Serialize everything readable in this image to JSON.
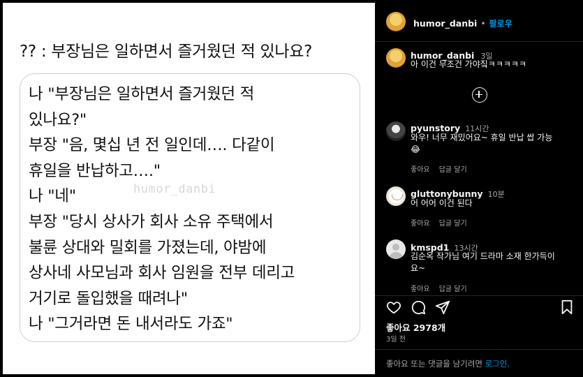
{
  "post_image": {
    "question": "?? : 부장님은 일하면서 즐거웠던 적 있나요?",
    "lines": [
      "나 \"부장님은 일하면서 즐거웠던 적",
      "있나요?\"",
      "부장 \"음, 몇십 년 전 일인데…. 다같이",
      "휴일을 반납하고….\"",
      "나 \"네\"",
      "부장 \"당시 상사가 회사 소유 주택에서",
      "불륜 상대와 밀회를 가졌는데, 야밤에",
      "상사네 사모님과 회사 임원을 전부 데리고",
      "거기로 돌입했을 때려나\"",
      "나 \"그거라면 돈 내서라도 가죠\""
    ],
    "watermark": "humor_danbi"
  },
  "header": {
    "username": "humor_danbi",
    "dot": "•",
    "follow_label": "팔로우"
  },
  "caption": {
    "username": "humor_danbi",
    "time": "3일",
    "text": "아 이건 무조건 가야짘ㅋㅋㅋㅋㅋ"
  },
  "comments": [
    {
      "username": "pyunstory",
      "time": "11시간",
      "text_lines": [
        "와우! 너무 재밌어요~ 휴일 반납 쌉 가능",
        "😂"
      ],
      "like": "좋아요",
      "reply": "답글 달기"
    },
    {
      "username": "gluttonybunny",
      "time": "10분",
      "text_lines": [
        "어 어어 이건 된다"
      ],
      "like": "좋아요",
      "reply": "답글 달기"
    },
    {
      "username": "kmspd1",
      "time": "13시간",
      "text_lines": [
        "김순옥 작가님 여기 드라마 소재 한가득이",
        "요~"
      ],
      "like": "좋아요",
      "reply": "답글 달기"
    }
  ],
  "stats": {
    "likes": "좋아요 2978개",
    "posted": "3일 전"
  },
  "footer": {
    "prompt": "좋아요 또는 댓글을 남기려면",
    "login": "로그인."
  },
  "icons": {
    "like": "heart-icon",
    "comment": "comment-icon",
    "share": "share-icon",
    "save": "bookmark-icon",
    "load_more": "plus-circle-icon"
  },
  "colors": {
    "link_blue": "#0095f6",
    "muted": "#a8a8a8",
    "background": "#000000"
  }
}
